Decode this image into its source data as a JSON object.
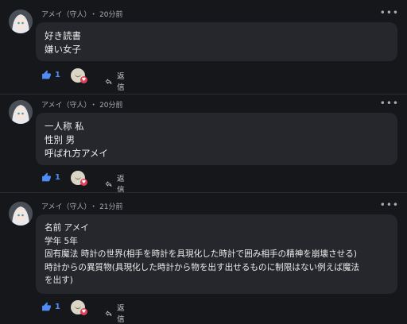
{
  "posts": [
    {
      "author": "アメイ（守人）",
      "separator": "・",
      "time": "20分前",
      "more": "•••",
      "lines": [
        "好き読書",
        "嫌い女子"
      ],
      "likes": "1",
      "reply_label": "返信"
    },
    {
      "author": "アメイ（守人）",
      "separator": "・",
      "time": "20分前",
      "more": "•••",
      "lines": [
        "一人称 私",
        "性別 男",
        "呼ばれ方アメイ"
      ],
      "likes": "1",
      "reply_label": "返信"
    },
    {
      "author": "アメイ（守人）",
      "separator": "・",
      "time": "21分前",
      "more": "•••",
      "lines": [
        "名前 アメイ",
        "学年 5年",
        "固有魔法 時計の世界(相手を時計を具現化した時計で囲み相手の精神を崩壊させる)",
        "時計からの異質物(具現化した時計から物を出す出せるものに制限はない例えば魔法",
        "を出す)"
      ],
      "likes": "1",
      "reply_label": "返信"
    }
  ],
  "colors": {
    "background": "#16171b",
    "bubble": "#26272c",
    "like": "#4d8df5",
    "heart": "#e2405b"
  },
  "icons": {
    "like": "thumbs-up-icon",
    "reaction": "emoji-heart-reaction-icon",
    "reply": "reply-arrow-icon",
    "more": "more-horizontal-icon"
  }
}
